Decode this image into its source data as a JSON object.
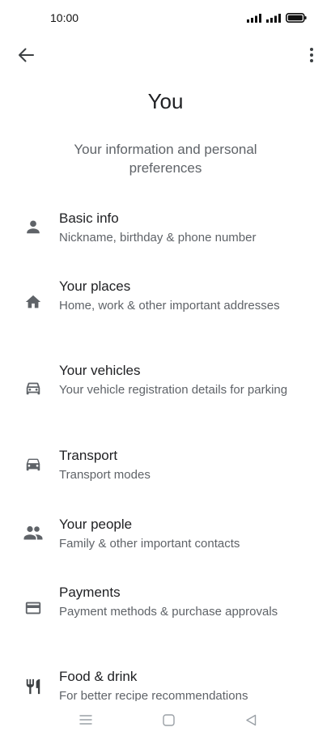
{
  "status": {
    "time": "10:00"
  },
  "page": {
    "title": "You",
    "subtitle": "Your information and personal preferences"
  },
  "items": [
    {
      "label": "Basic info",
      "desc": "Nickname, birthday & phone number",
      "icon": "person-icon"
    },
    {
      "label": "Your places",
      "desc": "Home, work & other important addresses",
      "icon": "home-icon"
    },
    {
      "label": "Your vehicles",
      "desc": "Your vehicle registration details for parking",
      "icon": "car-outline-icon"
    },
    {
      "label": "Transport",
      "desc": "Transport modes",
      "icon": "car-icon"
    },
    {
      "label": "Your people",
      "desc": "Family & other important contacts",
      "icon": "people-icon"
    },
    {
      "label": "Payments",
      "desc": "Payment methods & purchase approvals",
      "icon": "credit-card-icon"
    },
    {
      "label": "Food & drink",
      "desc": "For better recipe recommendations",
      "icon": "restaurant-icon"
    }
  ],
  "colors": {
    "icon": "#5f6368",
    "text": "#202124",
    "secondary": "#5f6368"
  }
}
